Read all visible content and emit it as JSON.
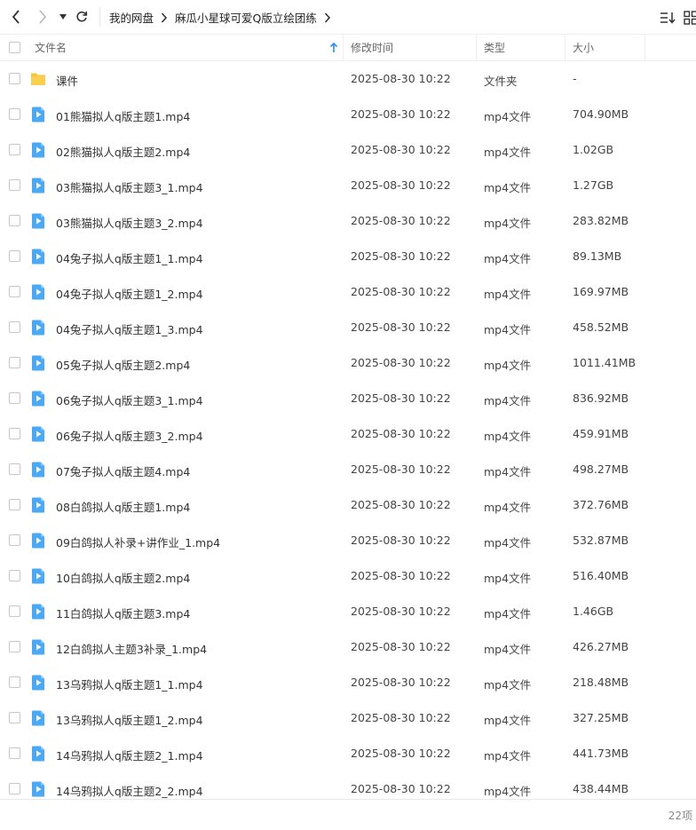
{
  "nav": {
    "back_icon": "chevron-left-icon",
    "forward_icon": "chevron-right-icon",
    "dropdown_icon": "caret-down-icon",
    "refresh_icon": "refresh-icon"
  },
  "breadcrumb": {
    "items": [
      "我的网盘",
      "麻瓜小星球可爱Q版立绘团练"
    ]
  },
  "toolbar": {
    "sort_icon": "sort-list-icon",
    "grid_icon": "grid-view-icon"
  },
  "columns": {
    "name": "文件名",
    "modified": "修改时间",
    "type": "类型",
    "size": "大小",
    "sort_indicator": "arrow-up-icon"
  },
  "colors": {
    "accent": "#2b8cf0",
    "folder": "#f9c33b",
    "video": "#4aa8f5"
  },
  "files": [
    {
      "name": "课件",
      "modified": "2025-08-30 10:22",
      "type": "文件夹",
      "size": "-",
      "kind": "folder"
    },
    {
      "name": "01熊猫拟人q版主题1.mp4",
      "modified": "2025-08-30 10:22",
      "type": "mp4文件",
      "size": "704.90MB",
      "kind": "video"
    },
    {
      "name": "02熊猫拟人q版主题2.mp4",
      "modified": "2025-08-30 10:22",
      "type": "mp4文件",
      "size": "1.02GB",
      "kind": "video"
    },
    {
      "name": "03熊猫拟人q版主题3_1.mp4",
      "modified": "2025-08-30 10:22",
      "type": "mp4文件",
      "size": "1.27GB",
      "kind": "video"
    },
    {
      "name": "03熊猫拟人q版主题3_2.mp4",
      "modified": "2025-08-30 10:22",
      "type": "mp4文件",
      "size": "283.82MB",
      "kind": "video"
    },
    {
      "name": "04兔子拟人q版主题1_1.mp4",
      "modified": "2025-08-30 10:22",
      "type": "mp4文件",
      "size": "89.13MB",
      "kind": "video"
    },
    {
      "name": "04兔子拟人q版主题1_2.mp4",
      "modified": "2025-08-30 10:22",
      "type": "mp4文件",
      "size": "169.97MB",
      "kind": "video"
    },
    {
      "name": "04兔子拟人q版主题1_3.mp4",
      "modified": "2025-08-30 10:22",
      "type": "mp4文件",
      "size": "458.52MB",
      "kind": "video"
    },
    {
      "name": "05兔子拟人q版主题2.mp4",
      "modified": "2025-08-30 10:22",
      "type": "mp4文件",
      "size": "1011.41MB",
      "kind": "video"
    },
    {
      "name": "06兔子拟人q版主题3_1.mp4",
      "modified": "2025-08-30 10:22",
      "type": "mp4文件",
      "size": "836.92MB",
      "kind": "video"
    },
    {
      "name": "06兔子拟人q版主题3_2.mp4",
      "modified": "2025-08-30 10:22",
      "type": "mp4文件",
      "size": "459.91MB",
      "kind": "video"
    },
    {
      "name": "07兔子拟人q版主题4.mp4",
      "modified": "2025-08-30 10:22",
      "type": "mp4文件",
      "size": "498.27MB",
      "kind": "video"
    },
    {
      "name": "08白鸽拟人q版主题1.mp4",
      "modified": "2025-08-30 10:22",
      "type": "mp4文件",
      "size": "372.76MB",
      "kind": "video"
    },
    {
      "name": "09白鸽拟人补录+讲作业_1.mp4",
      "modified": "2025-08-30 10:22",
      "type": "mp4文件",
      "size": "532.87MB",
      "kind": "video"
    },
    {
      "name": "10白鸽拟人q版主题2.mp4",
      "modified": "2025-08-30 10:22",
      "type": "mp4文件",
      "size": "516.40MB",
      "kind": "video"
    },
    {
      "name": "11白鸽拟人q版主题3.mp4",
      "modified": "2025-08-30 10:22",
      "type": "mp4文件",
      "size": "1.46GB",
      "kind": "video"
    },
    {
      "name": "12白鸽拟人主题3补录_1.mp4",
      "modified": "2025-08-30 10:22",
      "type": "mp4文件",
      "size": "426.27MB",
      "kind": "video"
    },
    {
      "name": "13乌鸦拟人q版主题1_1.mp4",
      "modified": "2025-08-30 10:22",
      "type": "mp4文件",
      "size": "218.48MB",
      "kind": "video"
    },
    {
      "name": "13乌鸦拟人q版主题1_2.mp4",
      "modified": "2025-08-30 10:22",
      "type": "mp4文件",
      "size": "327.25MB",
      "kind": "video"
    },
    {
      "name": "14乌鸦拟人q版主题2_1.mp4",
      "modified": "2025-08-30 10:22",
      "type": "mp4文件",
      "size": "441.73MB",
      "kind": "video"
    },
    {
      "name": "14乌鸦拟人q版主题2_2.mp4",
      "modified": "2025-08-30 10:22",
      "type": "mp4文件",
      "size": "438.44MB",
      "kind": "video"
    }
  ],
  "footer": {
    "item_count": "22项"
  }
}
